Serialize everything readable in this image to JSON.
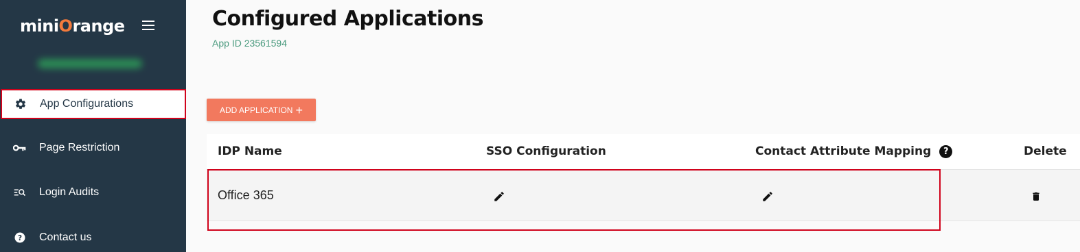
{
  "brand": {
    "logo_prefix": "mini",
    "logo_o": "O",
    "logo_suffix": "range",
    "accent": "#f27a3c"
  },
  "sidebar": {
    "items": [
      {
        "label": "App Configurations",
        "icon": "gear-icon",
        "active": true
      },
      {
        "label": "Page Restriction",
        "icon": "key-icon",
        "active": false
      },
      {
        "label": "Login Audits",
        "icon": "audit-search-icon",
        "active": false
      },
      {
        "label": "Contact us",
        "icon": "help-icon",
        "active": false
      }
    ]
  },
  "main": {
    "title": "Configured Applications",
    "app_id": "App ID 23561594",
    "add_button_label": "ADD APPLICATION",
    "add_button_icon": "plus-icon",
    "table": {
      "columns": [
        "IDP Name",
        "SSO Configuration",
        "Contact Attribute Mapping",
        "Delete"
      ],
      "rows": [
        {
          "idp_name": "Office 365",
          "sso_icon": "pencil-icon",
          "mapping_icon": "pencil-icon",
          "delete_icon": "trash-icon"
        }
      ]
    }
  }
}
